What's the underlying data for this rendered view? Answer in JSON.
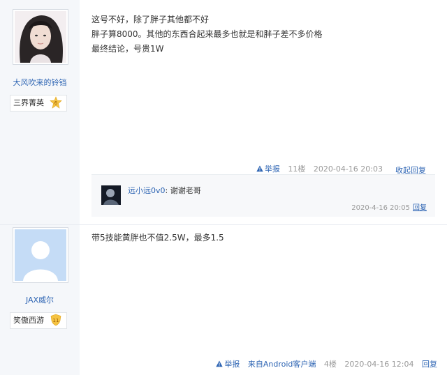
{
  "posts": [
    {
      "user": {
        "name": "大风吹来的铃铛",
        "badge": "三界菁英",
        "level": "6"
      },
      "content": [
        "这号不好，除了胖子其他都不好",
        "胖子算8000。其他的东西合起来最多也就是和胖子差不多价格",
        "最终结论，号贵1W"
      ],
      "tail": {
        "report": "举报",
        "floor": "11楼",
        "time": "2020-04-16 20:03"
      },
      "reply_toggle": "收起回复",
      "comments": [
        {
          "user": "远小远0v0",
          "text": ": 谢谢老哥",
          "time": "2020-4-16 20:05",
          "reply": "回复"
        }
      ]
    },
    {
      "user": {
        "name": "JAX威尔",
        "badge": "笑傲西游",
        "level": "11"
      },
      "content": [
        "带5技能黄胖也不值2.5W，最多1.5"
      ],
      "tail": {
        "report": "举报",
        "source": "来自Android客户端",
        "floor": "4楼",
        "time": "2020-04-16 12:04",
        "reply": "回复"
      }
    }
  ],
  "colors": {
    "link": "#2d64b3",
    "sidebar_bg": "#f5f7fa",
    "level_badge": "#f5c342"
  }
}
